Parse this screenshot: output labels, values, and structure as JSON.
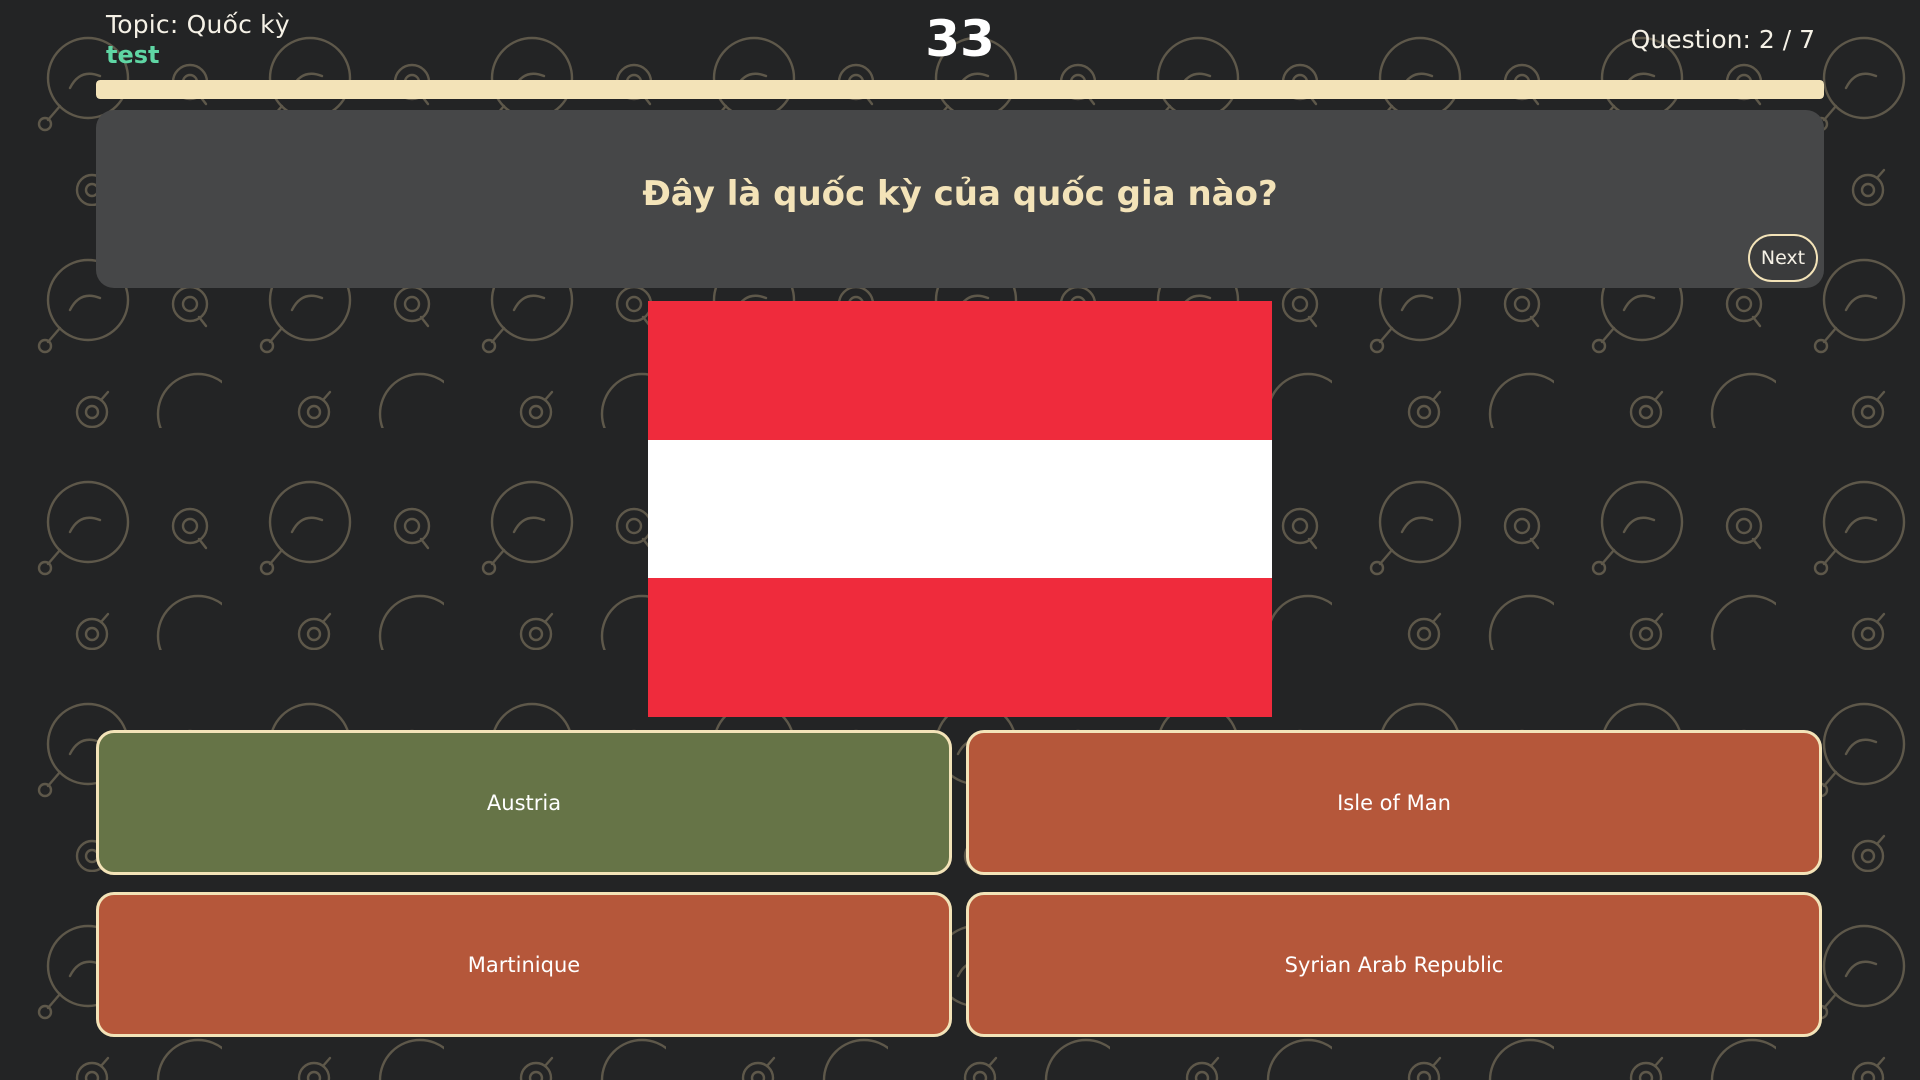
{
  "header": {
    "topic": "Topic: Quốc kỳ",
    "subtitle": "test",
    "timer": "33",
    "question_counter": "Question: 2 / 7",
    "progress_fraction": 1.0
  },
  "question": {
    "text": "Đây là quốc kỳ của quốc gia nào?",
    "next_label": "Next"
  },
  "flag": {
    "stripes": [
      "#ef2b3c",
      "#ffffff",
      "#ef2b3c"
    ]
  },
  "answers": [
    {
      "label": "Austria",
      "state": "correct"
    },
    {
      "label": "Isle of Man",
      "state": "wrong"
    },
    {
      "label": "Martinique",
      "state": "wrong"
    },
    {
      "label": "Syrian Arab Republic",
      "state": "wrong"
    }
  ],
  "colors": {
    "background": "#232425",
    "accent": "#f3e3b8",
    "subtitle": "#5fd6a4",
    "correct": "#667447",
    "wrong": "#b5573a",
    "card": "#464748"
  }
}
